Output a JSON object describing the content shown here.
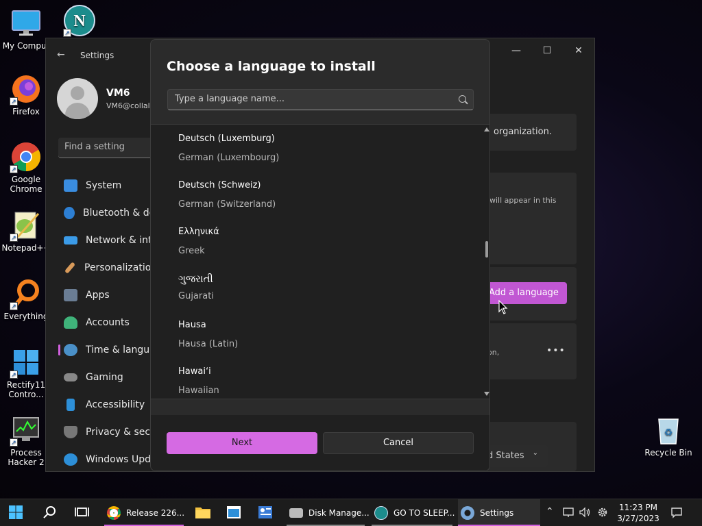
{
  "desktop": {
    "icons": [
      {
        "label": "My Comput",
        "icon": "monitor-icon"
      },
      {
        "label": "",
        "icon": "netscape-icon"
      },
      {
        "label": "Firefox",
        "icon": "firefox-icon"
      },
      {
        "label": "Google Chrome",
        "icon": "chrome-icon"
      },
      {
        "label": "Notepad++",
        "icon": "notepadpp-icon"
      },
      {
        "label": "Everything",
        "icon": "everything-icon"
      },
      {
        "label": "Rectify11 Contro...",
        "icon": "rectify11-icon"
      },
      {
        "label": "Process Hacker 2",
        "icon": "process-hacker-icon"
      },
      {
        "label": "Recycle Bin",
        "icon": "recycle-bin-icon"
      }
    ]
  },
  "settings": {
    "title": "Settings",
    "user_name": "VM6",
    "user_email": "VM6@collal",
    "search_placeholder": "Find a setting",
    "nav": [
      {
        "label": "System",
        "color": "#3a8de0"
      },
      {
        "label": "Bluetooth & de",
        "color": "#2d7fd3"
      },
      {
        "label": "Network & inte",
        "color": "#3b9be8"
      },
      {
        "label": "Personalization",
        "color": "#d89a5a"
      },
      {
        "label": "Apps",
        "color": "#6a7d94"
      },
      {
        "label": "Accounts",
        "color": "#3fb37a"
      },
      {
        "label": "Time & langua",
        "color": "#4a90c8"
      },
      {
        "label": "Gaming",
        "color": "#888888"
      },
      {
        "label": "Accessibility",
        "color": "#2d8fd8"
      },
      {
        "label": "Privacy & secu",
        "color": "#777777"
      },
      {
        "label": "Windows Upda",
        "color": "#2d8fd8"
      }
    ],
    "right_text_org": "organization.",
    "right_text_appear": "will appear in this",
    "add_language_label": "Add a language",
    "right_text_on": "on,",
    "region_value": "d States"
  },
  "dialog": {
    "title": "Choose a language to install",
    "search_placeholder": "Type a language name...",
    "languages": [
      {
        "native": "Deutsch (Luxemburg)",
        "english": "German (Luxembourg)"
      },
      {
        "native": "Deutsch (Schweiz)",
        "english": "German (Switzerland)"
      },
      {
        "native": "Ελληνικά",
        "english": "Greek"
      },
      {
        "native": "ગુજરાતી",
        "english": "Gujarati"
      },
      {
        "native": "Hausa",
        "english": "Hausa (Latin)"
      },
      {
        "native": "Hawaiʻi",
        "english": "Hawaiian"
      }
    ],
    "next_label": "Next",
    "cancel_label": "Cancel"
  },
  "taskbar": {
    "apps": [
      {
        "label": "Release 226...",
        "icon": "chrome-icon"
      },
      {
        "label": "Disk Manage...",
        "icon": "disk-management-icon"
      },
      {
        "label": "GO TO SLEEP...",
        "icon": "netscape-icon"
      },
      {
        "label": "Settings",
        "icon": "gear-icon"
      }
    ],
    "time": "11:23 PM",
    "date": "3/27/2023",
    "accent": "#d160de"
  }
}
